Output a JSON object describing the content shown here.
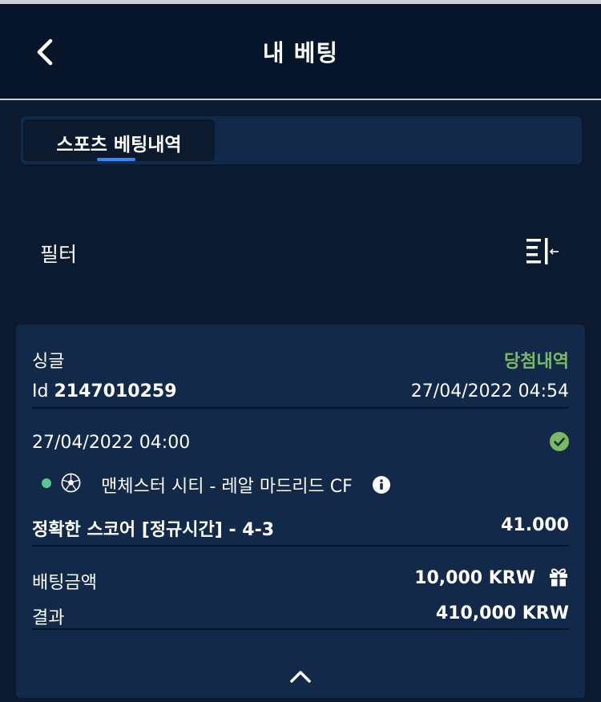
{
  "header": {
    "title": "내 베팅"
  },
  "tabs": [
    {
      "label": "스포츠 베팅내역"
    }
  ],
  "filter": {
    "label": "필터"
  },
  "bet": {
    "type": "싱글",
    "status": "당첨내역",
    "id_prefix": "Id",
    "id": "2147010259",
    "placed_at": "27/04/2022 04:54",
    "event_time": "27/04/2022 04:00",
    "match": "맨체스터 시티 - 레알 마드리드 CF",
    "selection": "정확한 스코어 [정규시간] - 4-3",
    "odds": "41.000",
    "stake_label": "배팅금액",
    "stake": "10,000 KRW",
    "result_label": "결과",
    "result": "410,000 KRW"
  },
  "colors": {
    "background": "#0b1a2e",
    "header": "#07152a",
    "card": "#12294a",
    "accent": "#3a87f5",
    "won": "#7cb860",
    "live_dot": "#5cc58c"
  }
}
